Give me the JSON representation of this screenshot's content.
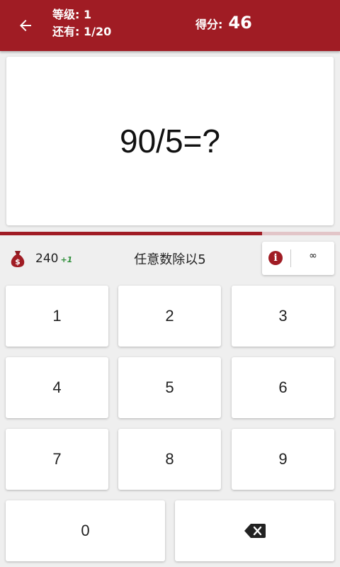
{
  "header": {
    "level_label": "等级:",
    "level_value": "1",
    "remaining_label": "还有:",
    "remaining_value": "1/20",
    "score_label": "得分:",
    "score_value": "46"
  },
  "question": {
    "text": "90/5=?"
  },
  "progress": {
    "fraction": 0.77
  },
  "info_bar": {
    "coin_icon": "money-bag-icon",
    "coins": "240",
    "coin_bonus": "+1",
    "hint": "任意数除以5",
    "info_icon": "info-icon",
    "info_symbol": "i",
    "timer": "∞"
  },
  "keypad": {
    "keys": [
      "1",
      "2",
      "3",
      "4",
      "5",
      "6",
      "7",
      "8",
      "9"
    ],
    "zero": "0",
    "backspace_icon": "backspace-icon"
  },
  "colors": {
    "accent": "#a01c24",
    "bonus": "#2f8f3a",
    "background": "#efefef"
  }
}
